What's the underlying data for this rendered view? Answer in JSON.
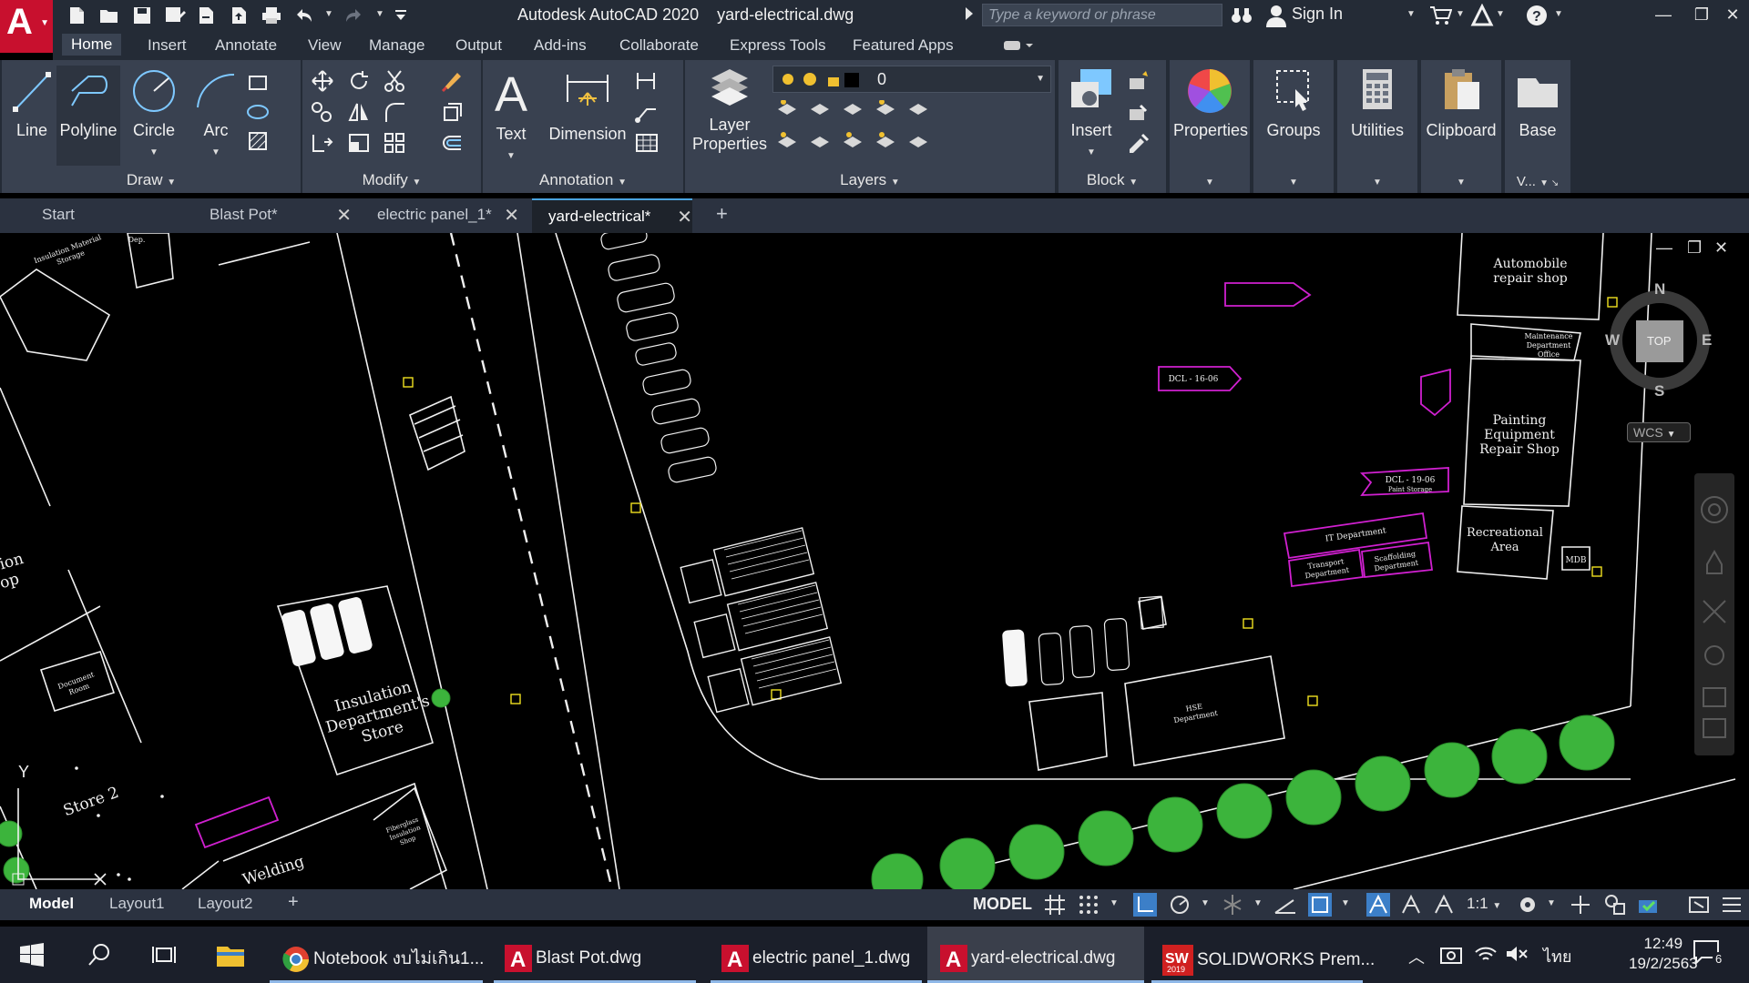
{
  "app": {
    "logo_letter": "A",
    "title": "Autodesk AutoCAD 2020",
    "filename": "yard-electrical.dwg",
    "search_placeholder": "Type a keyword or phrase",
    "sign_in": "Sign In"
  },
  "ribbon_tabs": [
    "Home",
    "Insert",
    "Annotate",
    "View",
    "Manage",
    "Output",
    "Add-ins",
    "Collaborate",
    "Express Tools",
    "Featured Apps"
  ],
  "ribbon": {
    "draw": {
      "title": "Draw",
      "tools": [
        "Line",
        "Polyline",
        "Circle",
        "Arc"
      ]
    },
    "modify": {
      "title": "Modify"
    },
    "annotation": {
      "title": "Annotation",
      "tools": [
        "Text",
        "Dimension"
      ]
    },
    "layers": {
      "title": "Layers",
      "layer_properties_line1": "Layer",
      "layer_properties_line2": "Properties",
      "current_layer": "0"
    },
    "block": {
      "title": "Block",
      "insert": "Insert"
    },
    "properties": "Properties",
    "groups": "Groups",
    "utilities": "Utilities",
    "clipboard": "Clipboard",
    "base": "Base",
    "view_short": "V..."
  },
  "doc_tabs": [
    {
      "label": "Start",
      "closable": false
    },
    {
      "label": "Blast Pot*",
      "closable": true
    },
    {
      "label": "electric panel_1*",
      "closable": true
    },
    {
      "label": "yard-electrical*",
      "closable": true
    }
  ],
  "drawing_labels": {
    "automobile": [
      "Automobile",
      "repair shop"
    ],
    "maintenance": [
      "Maintenance",
      "Department",
      "Office"
    ],
    "painting": [
      "Painting",
      "Equipment",
      "Repair Shop"
    ],
    "recreational": [
      "Recreational",
      "Area"
    ],
    "insulation": [
      "Insulation",
      "Department's",
      "Store"
    ],
    "store2": "Store 2",
    "welding": "Welding",
    "ion": "ion",
    "op": "op",
    "document": [
      "Document",
      "Room"
    ],
    "fiberglass": [
      "Fiberglass",
      "Insulation",
      "Shop"
    ],
    "dcl16": "DCL - 16-06",
    "dcl19": [
      "DCL - 19-06",
      "Paint Storage"
    ],
    "it_dept": "IT Department",
    "transport": [
      "Transport",
      "Department"
    ],
    "scaffolding": [
      "Scaffolding",
      "Department"
    ],
    "hse": [
      "HSE",
      "Department"
    ],
    "mdb": "MDB",
    "corner_tl1": "Insulation Material",
    "corner_tl2": "Storage",
    "corner_dep": "Dep."
  },
  "viewcube": {
    "n": "N",
    "s": "S",
    "e": "E",
    "w": "W",
    "top": "TOP",
    "wcs": "WCS"
  },
  "ucs": {
    "y": "Y"
  },
  "layout_tabs": [
    "Model",
    "Layout1",
    "Layout2"
  ],
  "status": {
    "model": "MODEL",
    "scale": "1:1"
  },
  "taskbar": {
    "tasks": [
      "Notebook งบไม่เกิน1...",
      "Blast Pot.dwg",
      "electric panel_1.dwg",
      "yard-electrical.dwg",
      "SOLIDWORKS Prem..."
    ],
    "sw_year": "2019",
    "lang": "ไทย",
    "time": "12:49",
    "date": "19/2/2563",
    "notifications": "6"
  },
  "colors": {
    "ribbon_bg": "#242b36",
    "panel_bg": "#394150",
    "accent_red": "#c8102e",
    "magenta": "#d020d0",
    "tree_green": "#3cb43c"
  }
}
